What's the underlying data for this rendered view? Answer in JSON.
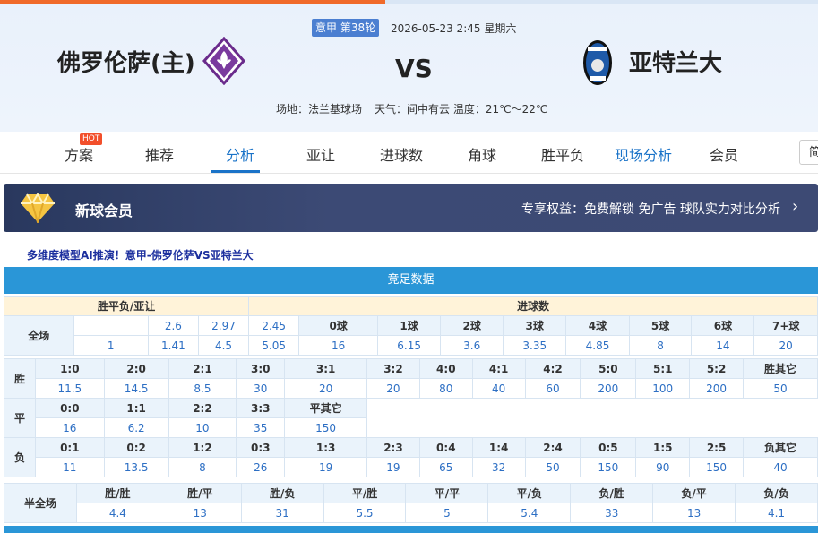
{
  "header": {
    "league_round": "意甲 第38轮",
    "datetime": "2026-05-23 2:45 星期六",
    "home_team": "佛罗伦萨(主)",
    "away_team": "亚特兰大",
    "vs": "VS",
    "venue": "场地：法兰基球场",
    "weather": "天气：间中有云 温度：21℃～22℃"
  },
  "nav": {
    "hot_badge": "HOT",
    "items": [
      "方案",
      "推荐",
      "分析",
      "亚让",
      "进球数",
      "角球",
      "胜平负",
      "现场分析",
      "会员"
    ],
    "active": "分析",
    "extra_button": "简"
  },
  "vip": {
    "title": "新球会员",
    "desc": "专享权益：免费解锁 免广告 球队实力对比分析",
    "arrow": "›"
  },
  "promo": "多维度模型AI推演！意甲-佛罗伦萨VS亚特兰大",
  "section_title": "竞足数据",
  "odds": {
    "h_wdl": "胜平负/亚让",
    "h_goals": "进球数",
    "full_label": "全场",
    "wdl_row1": [
      "",
      "2.6",
      "2.97",
      "2.45"
    ],
    "wdl_row2": [
      "1",
      "1.41",
      "4.5",
      "5.05"
    ],
    "goal_labels": [
      "0球",
      "1球",
      "2球",
      "3球",
      "4球",
      "5球",
      "6球",
      "7+球"
    ],
    "goal_values": [
      "16",
      "6.15",
      "3.6",
      "3.35",
      "4.85",
      "8",
      "14",
      "20"
    ],
    "win_label": "胜",
    "win_scores": [
      "1:0",
      "2:0",
      "2:1",
      "3:0",
      "3:1",
      "3:2",
      "4:0",
      "4:1",
      "4:2",
      "5:0",
      "5:1",
      "5:2",
      "胜其它"
    ],
    "win_values": [
      "11.5",
      "14.5",
      "8.5",
      "30",
      "20",
      "20",
      "80",
      "40",
      "60",
      "200",
      "100",
      "200",
      "50"
    ],
    "draw_label": "平",
    "draw_scores": [
      "0:0",
      "1:1",
      "2:2",
      "3:3",
      "平其它"
    ],
    "draw_values": [
      "16",
      "6.2",
      "10",
      "35",
      "150"
    ],
    "loss_label": "负",
    "loss_scores": [
      "0:1",
      "0:2",
      "1:2",
      "0:3",
      "1:3",
      "2:3",
      "0:4",
      "1:4",
      "2:4",
      "0:5",
      "1:5",
      "2:5",
      "负其它"
    ],
    "loss_values": [
      "11",
      "13.5",
      "8",
      "26",
      "19",
      "19",
      "65",
      "32",
      "50",
      "150",
      "90",
      "150",
      "40"
    ],
    "half_label": "半全场",
    "half_labels": [
      "胜/胜",
      "胜/平",
      "胜/负",
      "平/胜",
      "平/平",
      "平/负",
      "负/胜",
      "负/平",
      "负/负"
    ],
    "half_values": [
      "4.4",
      "13",
      "31",
      "5.5",
      "5",
      "5.4",
      "33",
      "13",
      "4.1"
    ]
  },
  "colors": {
    "accent": "#1a73c8",
    "table_header": "#2a96d7",
    "odds_value": "#2d6fc4",
    "hot": "#f24f2b"
  }
}
